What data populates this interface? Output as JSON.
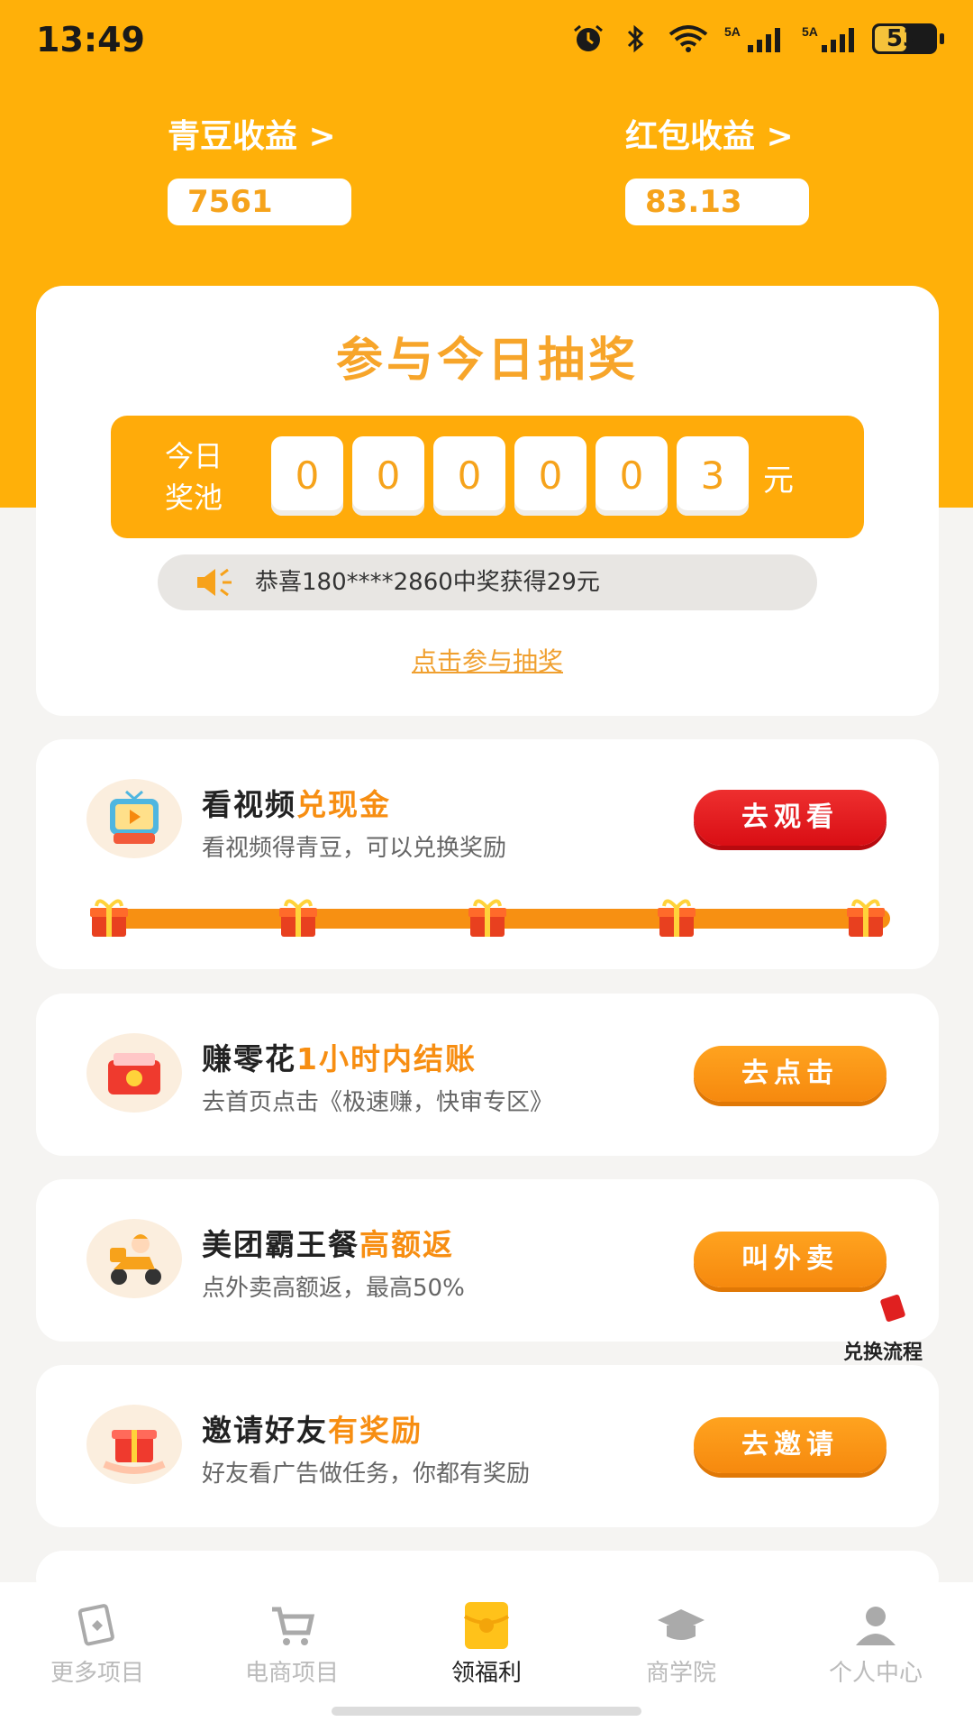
{
  "status_bar": {
    "time": "13:49",
    "battery": "53",
    "battery_level": 0.53,
    "icons": [
      "alarm-icon",
      "bluetooth-icon",
      "wifi-icon",
      "signal-5a-icon",
      "signal-5a-icon",
      "battery-icon"
    ]
  },
  "earnings": {
    "beans_label": "青豆收益 >",
    "beans_value": "7561",
    "redpack_label": "红包收益 >",
    "redpack_value": "83.13"
  },
  "lottery": {
    "title": "参与今日抽奖",
    "pool_label": "今日奖池",
    "digits": [
      "0",
      "0",
      "0",
      "0",
      "0",
      "3"
    ],
    "unit": "元",
    "notice": "恭喜180****2860中奖获得29元",
    "link": "点击参与抽奖"
  },
  "tasks": [
    {
      "title": "看视频",
      "highlight": "兑现金",
      "subtitle": "看视频得青豆，可以兑换奖励",
      "button": "去观看",
      "icon": "video-tv-icon"
    },
    {
      "title": "赚零花",
      "highlight": "1小时内结账",
      "subtitle": "去首页点击《极速赚，快审专区》",
      "button": "去点击",
      "icon": "money-box-icon"
    },
    {
      "title": "美团霸王餐",
      "highlight": "高额返",
      "subtitle": "点外卖高额返，最高50%",
      "button": "叫外卖",
      "icon": "delivery-scooter-icon"
    },
    {
      "title": "邀请好友",
      "highlight": "有奖励",
      "subtitle": "好友看广告做任务，你都有奖励",
      "button": "去邀请",
      "icon": "gift-hands-icon"
    }
  ],
  "float_widget": {
    "label": "兑换流程"
  },
  "colors": {
    "brand": "#ffb009",
    "accent": "#f78e12",
    "red": "#e01e1e"
  },
  "tabbar": {
    "active": 2,
    "tabs": [
      {
        "label": "更多项目",
        "icon": "project-card-icon"
      },
      {
        "label": "电商项目",
        "icon": "shopping-cart-icon"
      },
      {
        "label": "领福利",
        "icon": "red-envelope-icon"
      },
      {
        "label": "商学院",
        "icon": "graduation-cap-icon"
      },
      {
        "label": "个人中心",
        "icon": "person-icon"
      }
    ]
  }
}
